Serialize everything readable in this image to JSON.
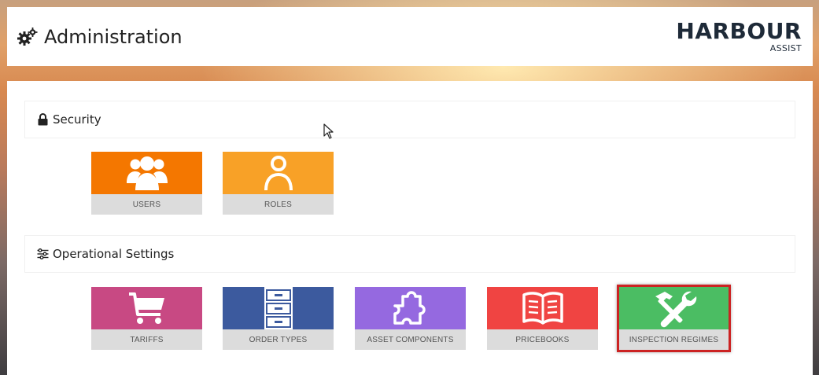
{
  "header": {
    "title": "Administration",
    "logo_main": "HARBOUR",
    "logo_sub": "ASSIST"
  },
  "sections": [
    {
      "title": "Security",
      "icon": "lock-icon",
      "tiles": [
        {
          "label": "USERS",
          "icon": "users-icon",
          "color": "#f47700"
        },
        {
          "label": "ROLES",
          "icon": "user-icon",
          "color": "#f8a127"
        }
      ]
    },
    {
      "title": "Operational Settings",
      "icon": "sliders-icon",
      "tiles": [
        {
          "label": "TARIFFS",
          "icon": "shopping-cart-icon",
          "color": "#c84983"
        },
        {
          "label": "ORDER TYPES",
          "icon": "filing-cabinet-icon",
          "color": "#3c5a9e"
        },
        {
          "label": "ASSET COMPONENTS",
          "icon": "puzzle-piece-icon",
          "color": "#9569e0"
        },
        {
          "label": "PRICEBOOKS",
          "icon": "open-book-icon",
          "color": "#f04442"
        },
        {
          "label": "INSPECTION REGIMES",
          "icon": "hammer-wrench-icon",
          "color": "#4bbd63",
          "highlighted": true
        }
      ]
    }
  ],
  "colors": {
    "tile_label_bg": "#dcdcdc",
    "highlight_border": "#cc2323"
  }
}
